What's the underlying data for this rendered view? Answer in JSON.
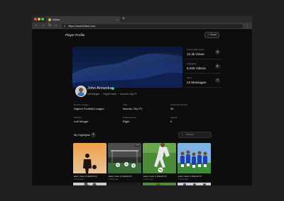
{
  "browser": {
    "tab_title": "fotbal",
    "url": "https://www.fotbal.com",
    "new_tab_symbol": "+",
    "close_symbol": "×",
    "dots": [
      "#e5534b",
      "#e2b93b",
      "#57b368"
    ]
  },
  "page": {
    "title": "Player Profile",
    "share_label": "Share"
  },
  "player": {
    "name": "John Arowoka",
    "position": "Left Winger",
    "foot": "Right Footer",
    "club": "Ikorodu City FC"
  },
  "stats": [
    {
      "label": "Total Profile Views",
      "value": "12.3k Views",
      "icon": "eye-icon"
    },
    {
      "label": "Highlights",
      "value": "6,045 Videos",
      "icon": "video-icon"
    },
    {
      "label": "Inbox",
      "value": "23 Messages",
      "icon": "message-icon"
    }
  ],
  "details": [
    {
      "label": "Current League",
      "value": "Nigeria Football League"
    },
    {
      "label": "Club",
      "value": "Ikorodu City FC"
    },
    {
      "label": "Goals this Season",
      "value": "34"
    },
    {
      "label": "Position",
      "value": "Left Winger"
    },
    {
      "label": "Preferred Foot",
      "value": "Right"
    },
    {
      "label": "Assists",
      "value": "0"
    }
  ],
  "highlights": {
    "title": "My Highlights",
    "search_placeholder": "Search",
    "cards": [
      {
        "caption": "Early Years in Madrid FC",
        "time": "2 hours ago",
        "badge": ""
      },
      {
        "caption": "Early Years in Madrid FC",
        "time": "2 hours ago",
        "badge": "0:45"
      },
      {
        "caption": "Early Years in Madrid FC",
        "time": "2 hours ago",
        "badge": ""
      },
      {
        "caption": "Early Years in Madrid FC",
        "time": "2 hours ago",
        "badge": ""
      },
      {
        "caption": "",
        "time": "",
        "badge": ""
      },
      {
        "caption": "",
        "time": "",
        "badge": ""
      },
      {
        "caption": "",
        "time": "",
        "badge": ""
      },
      {
        "caption": "",
        "time": "",
        "badge": ""
      }
    ]
  }
}
